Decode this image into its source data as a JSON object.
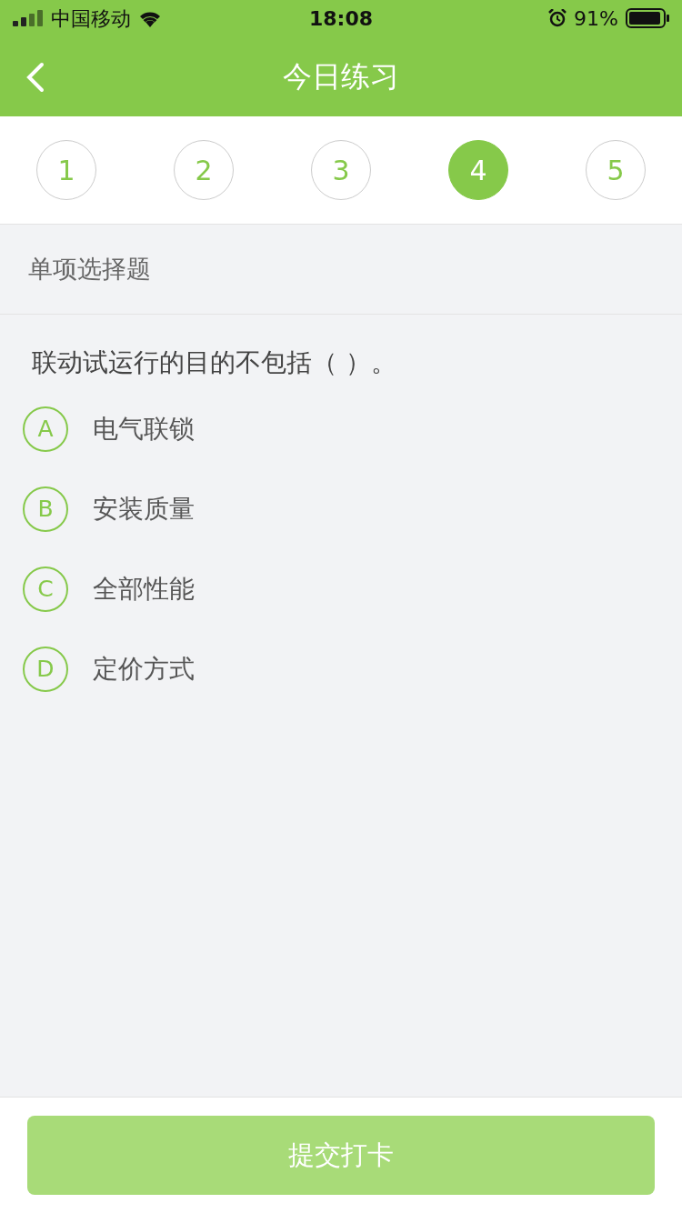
{
  "status_bar": {
    "carrier": "中国移动",
    "time": "18:08",
    "battery": "91%"
  },
  "header": {
    "title": "今日练习"
  },
  "questions": [
    {
      "label": "1",
      "selected": false
    },
    {
      "label": "2",
      "selected": false
    },
    {
      "label": "3",
      "selected": false
    },
    {
      "label": "4",
      "selected": true
    },
    {
      "label": "5",
      "selected": false
    }
  ],
  "section": {
    "title": "单项选择题"
  },
  "question": {
    "text": "联动试运行的目的不包括（ ）。",
    "options": [
      {
        "letter": "A",
        "text": "电气联锁",
        "selected": false
      },
      {
        "letter": "B",
        "text": "安装质量",
        "selected": false
      },
      {
        "letter": "C",
        "text": "全部性能",
        "selected": false
      },
      {
        "letter": "D",
        "text": "定价方式",
        "selected": false
      }
    ]
  },
  "submit": {
    "label": "提交打卡",
    "disabled": true
  }
}
